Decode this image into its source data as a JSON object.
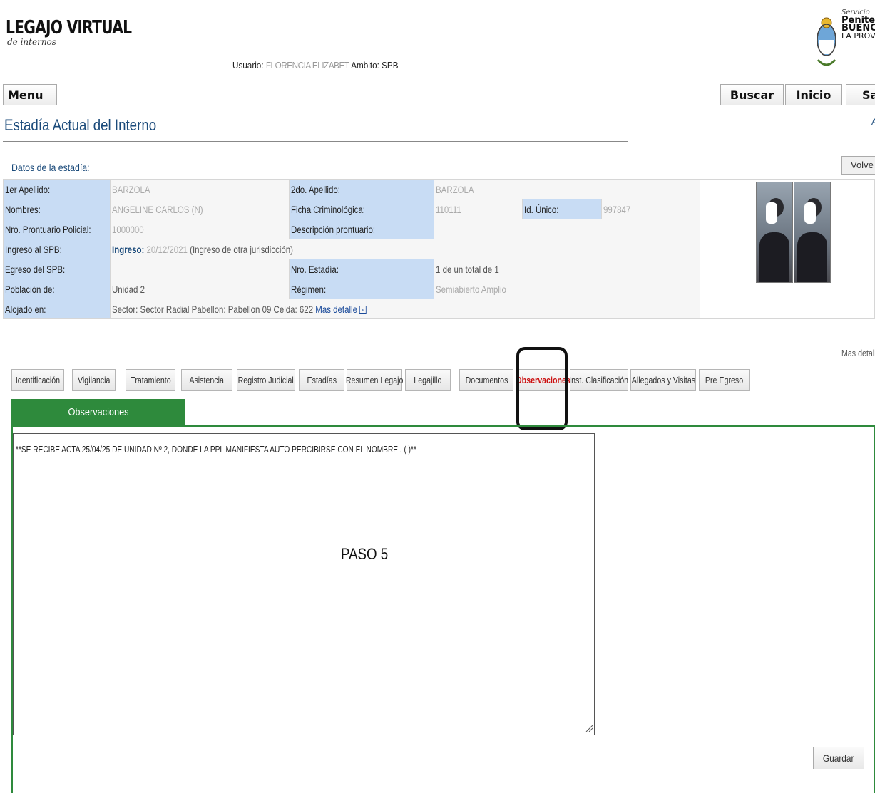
{
  "header": {
    "logo_title": "LEGAJO VIRTUAL",
    "logo_subtitle": "de internos",
    "user_label": "Usuario:",
    "user_value": "FLORENCIA ELIZABET",
    "ambito_label": "Ambito:",
    "ambito_value": "SPB",
    "org_line1": "Servicio",
    "org_line2": "Penitencia",
    "org_line3": "BUENOS AI",
    "org_line4": "LA PROVIN"
  },
  "nav": {
    "menu": "Menu",
    "buscar": "Buscar",
    "inicio": "Inicio",
    "salir": "Sa"
  },
  "page": {
    "title": "Estadía Actual del Interno",
    "corner_link": "A",
    "volver": "Volve",
    "section_label": "Datos de la estadía:",
    "mas_detalle_right": "Mas detall"
  },
  "datos": {
    "apellido1_label": "1er Apellido:",
    "apellido1_value": "BARZOLA",
    "apellido2_label": "2do. Apellido:",
    "apellido2_value": "BARZOLA",
    "nombres_label": "Nombres:",
    "nombres_value": "ANGELINE CARLOS (N)",
    "ficha_label": "Ficha Criminológica:",
    "ficha_value": "110111",
    "idunico_label": "Id. Único:",
    "idunico_value": "997847",
    "prontuario_label": "Nro. Prontuario Policial:",
    "prontuario_value": "1000000",
    "desc_prontuario_label": "Descripción prontuario:",
    "desc_prontuario_value": "",
    "ingreso_label": "Ingreso al SPB:",
    "ingreso_prefix": "Ingreso:",
    "ingreso_date": "20/12/2021",
    "ingreso_note": "(Ingreso de otra jurisdicción)",
    "egreso_label": "Egreso del SPB:",
    "egreso_value": "",
    "nro_estadia_label": "Nro. Estadía:",
    "nro_estadia_value": "1 de un total de 1",
    "poblacion_label": "Población de:",
    "poblacion_value": "Unidad 2",
    "regimen_label": "Régimen:",
    "regimen_value": "Semiabierto Amplio",
    "alojado_label": "Alojado en:",
    "alojado_value": "Sector: Sector Radial Pabellon: Pabellon 09 Celda: 622",
    "mas_detalle": "Mas detalle"
  },
  "tabs": [
    {
      "label": "Identificación"
    },
    {
      "label": "Vigilancia"
    },
    {
      "label": "Tratamiento"
    },
    {
      "label": "Asistencia"
    },
    {
      "label": "Registro Judicial"
    },
    {
      "label": "Estadías"
    },
    {
      "label": "Resumen Legajo"
    },
    {
      "label": "Legajillo"
    },
    {
      "label": "Documentos"
    },
    {
      "label": "Observaciones",
      "active": true
    },
    {
      "label": "Inst. Clasificación"
    },
    {
      "label": "Allegados y Visitas"
    },
    {
      "label": "Pre Egreso"
    }
  ],
  "observaciones": {
    "subtab_label": "Observaciones",
    "text": "**SE RECIBE ACTA 25/04/25 DE UNIDAD Nº 2, DONDE LA PPL MANIFIESTA AUTO PERCIBIRSE CON EL NOMBRE .                  (   )**",
    "annotation": "PASO 5",
    "save_button": "Guardar"
  },
  "colors": {
    "accent_green": "#2e8a3c",
    "label_blue": "#c8dcf4",
    "title_blue": "#1a4a7a",
    "active_tab_red": "#cc1010"
  }
}
